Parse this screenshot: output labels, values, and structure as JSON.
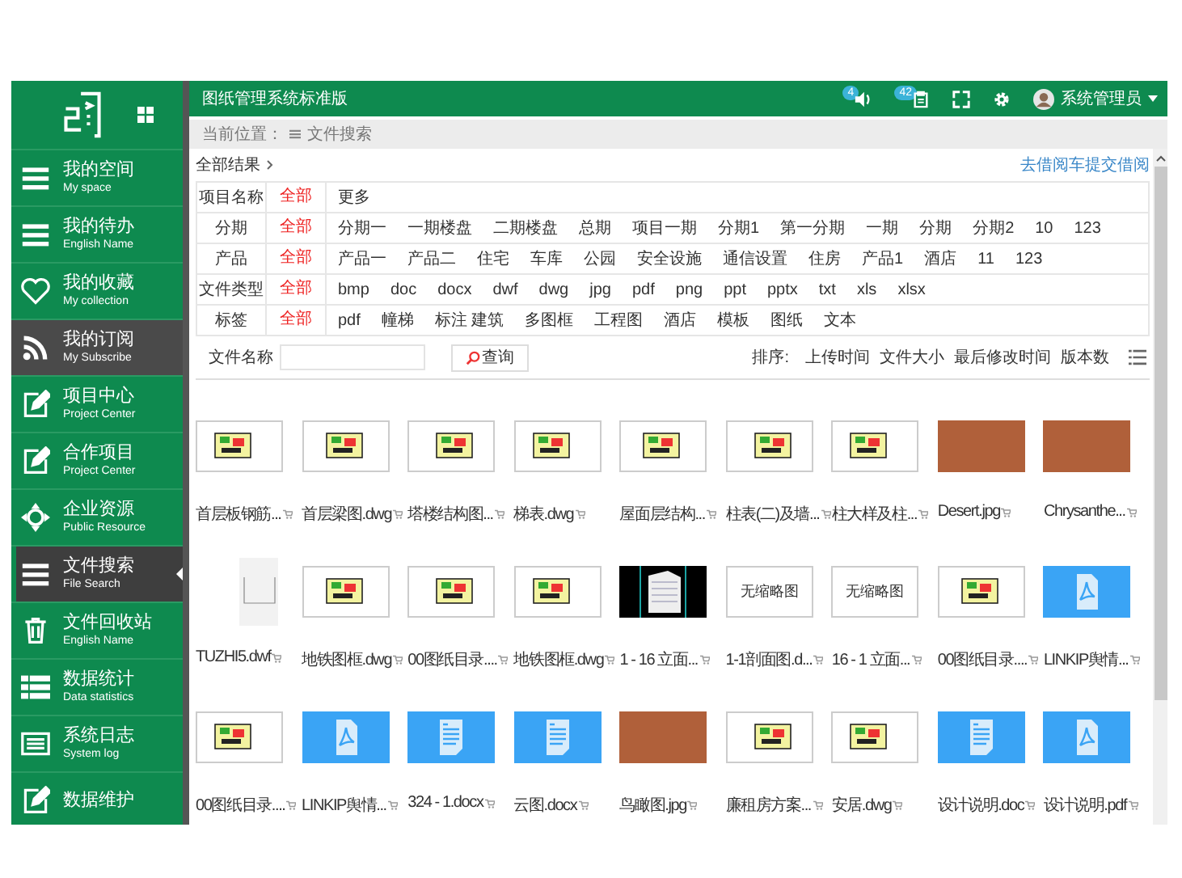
{
  "header": {
    "title": "图纸管理系统标准版",
    "notifications": [
      {
        "kind": "speaker",
        "badge": "4"
      },
      {
        "kind": "document",
        "badge": "42"
      }
    ],
    "user": "系统管理员"
  },
  "sidebar": {
    "items": [
      {
        "title": "我的空间",
        "subtitle": "My space",
        "kind": "menu",
        "selected": false,
        "hovered": false
      },
      {
        "title": "我的待办",
        "subtitle": "English Name",
        "kind": "menu",
        "selected": false,
        "hovered": false
      },
      {
        "title": "我的收藏",
        "subtitle": "My collection",
        "kind": "heart",
        "selected": false,
        "hovered": false
      },
      {
        "title": "我的订阅",
        "subtitle": "My Subscribe",
        "kind": "rss",
        "selected": false,
        "hovered": true
      },
      {
        "title": "项目中心",
        "subtitle": "Project Center",
        "kind": "edit",
        "selected": false,
        "hovered": false
      },
      {
        "title": "合作项目",
        "subtitle": "Project Center",
        "kind": "edit",
        "selected": false,
        "hovered": false
      },
      {
        "title": "企业资源",
        "subtitle": "Public Resource",
        "kind": "move",
        "selected": false,
        "hovered": false
      },
      {
        "title": "文件搜索",
        "subtitle": "File Search",
        "kind": "menu",
        "selected": true,
        "hovered": false
      },
      {
        "title": "文件回收站",
        "subtitle": "English Name",
        "kind": "trash",
        "selected": false,
        "hovered": false
      },
      {
        "title": "数据统计",
        "subtitle": "Data statistics",
        "kind": "table",
        "selected": false,
        "hovered": false
      },
      {
        "title": "系统日志",
        "subtitle": "System log",
        "kind": "log",
        "selected": false,
        "hovered": false
      },
      {
        "title": "数据维护",
        "kind": "edit",
        "selected": false,
        "hovered": false
      }
    ]
  },
  "breadcrumb": {
    "label": "当前位置：",
    "current": "文件搜索"
  },
  "results": {
    "label": "全部结果",
    "link": "去借阅车提交借阅"
  },
  "filters": [
    {
      "label": "项目名称",
      "options": [
        {
          "text": "全部",
          "selected": true
        },
        {
          "text": "更多",
          "selected": false
        }
      ]
    },
    {
      "label": "分期",
      "options": [
        {
          "text": "全部",
          "selected": true
        },
        {
          "text": "分期一",
          "selected": false
        },
        {
          "text": "一期楼盘",
          "selected": false
        },
        {
          "text": "二期楼盘",
          "selected": false
        },
        {
          "text": "总期",
          "selected": false
        },
        {
          "text": "项目一期",
          "selected": false
        },
        {
          "text": "分期1",
          "selected": false
        },
        {
          "text": "第一分期",
          "selected": false
        },
        {
          "text": "一期",
          "selected": false
        },
        {
          "text": "分期",
          "selected": false
        },
        {
          "text": "分期2",
          "selected": false
        },
        {
          "text": "10",
          "selected": false
        },
        {
          "text": "123",
          "selected": false
        }
      ]
    },
    {
      "label": "产品",
      "options": [
        {
          "text": "全部",
          "selected": true
        },
        {
          "text": "产品一",
          "selected": false
        },
        {
          "text": "产品二",
          "selected": false
        },
        {
          "text": "住宅",
          "selected": false
        },
        {
          "text": "车库",
          "selected": false
        },
        {
          "text": "公园",
          "selected": false
        },
        {
          "text": "安全设施",
          "selected": false
        },
        {
          "text": "通信设置",
          "selected": false
        },
        {
          "text": "住房",
          "selected": false
        },
        {
          "text": "产品1",
          "selected": false
        },
        {
          "text": "酒店",
          "selected": false
        },
        {
          "text": "11",
          "selected": false
        },
        {
          "text": "123",
          "selected": false
        }
      ]
    },
    {
      "label": "文件类型",
      "options": [
        {
          "text": "全部",
          "selected": true
        },
        {
          "text": "bmp",
          "selected": false
        },
        {
          "text": "doc",
          "selected": false
        },
        {
          "text": "docx",
          "selected": false
        },
        {
          "text": "dwf",
          "selected": false
        },
        {
          "text": "dwg",
          "selected": false
        },
        {
          "text": "jpg",
          "selected": false
        },
        {
          "text": "pdf",
          "selected": false
        },
        {
          "text": "png",
          "selected": false
        },
        {
          "text": "ppt",
          "selected": false
        },
        {
          "text": "pptx",
          "selected": false
        },
        {
          "text": "txt",
          "selected": false
        },
        {
          "text": "xls",
          "selected": false
        },
        {
          "text": "xlsx",
          "selected": false
        }
      ]
    },
    {
      "label": "标签",
      "options": [
        {
          "text": "全部",
          "selected": true
        },
        {
          "text": "pdf",
          "selected": false
        },
        {
          "text": "幢梯",
          "selected": false
        },
        {
          "text": "标注 建筑",
          "selected": false
        },
        {
          "text": "多图框",
          "selected": false
        },
        {
          "text": "工程图",
          "selected": false
        },
        {
          "text": "酒店",
          "selected": false
        },
        {
          "text": "模板",
          "selected": false
        },
        {
          "text": "图纸",
          "selected": false
        },
        {
          "text": "文本",
          "selected": false
        }
      ]
    }
  ],
  "search": {
    "label": "文件名称",
    "button": "查询"
  },
  "sort": {
    "label": "排序:",
    "options": [
      "上传时间",
      "文件大小",
      "最后修改时间",
      "版本数"
    ]
  },
  "files": [
    {
      "name": "首层板钢筋...",
      "kind": "drawing"
    },
    {
      "name": "首层梁图.dwg",
      "kind": "drawing"
    },
    {
      "name": "塔楼结构图...",
      "kind": "drawing"
    },
    {
      "name": "梯表.dwg",
      "kind": "drawing"
    },
    {
      "name": "屋面层结构...",
      "kind": "drawing"
    },
    {
      "name": "柱表(二)及墙...",
      "kind": "drawing"
    },
    {
      "name": "柱大样及柱...",
      "kind": "drawing"
    },
    {
      "name": "Desert.jpg",
      "kind": "photo"
    },
    {
      "name": "Chrysanthe...",
      "kind": "photo"
    },
    {
      "name": "TUZHI5.dwf",
      "kind": "sheet"
    },
    {
      "name": "地铁图框.dwg",
      "kind": "drawing"
    },
    {
      "name": "00图纸目录....",
      "kind": "drawing"
    },
    {
      "name": "地铁图框.dwg",
      "kind": "drawing"
    },
    {
      "name": "1 - 16 立面...",
      "kind": "dark"
    },
    {
      "name": "1-1剖面图.d...",
      "kind": "none",
      "thumb_text": "无缩略图"
    },
    {
      "name": "16 - 1 立面...",
      "kind": "none",
      "thumb_text": "无缩略图"
    },
    {
      "name": "00图纸目录....",
      "kind": "drawing"
    },
    {
      "name": "LINKIP舆情...",
      "kind": "pdf"
    },
    {
      "name": "00图纸目录....",
      "kind": "drawing"
    },
    {
      "name": "LINKIP舆情...",
      "kind": "pdf"
    },
    {
      "name": "324 - 1.docx",
      "kind": "word"
    },
    {
      "name": "云图.docx",
      "kind": "word"
    },
    {
      "name": "鸟瞰图.jpg",
      "kind": "photo"
    },
    {
      "name": "廉租房方案...",
      "kind": "drawing"
    },
    {
      "name": "安居.dwg",
      "kind": "drawing"
    },
    {
      "name": "设计说明.doc",
      "kind": "word"
    },
    {
      "name": "设计说明.pdf",
      "kind": "pdf"
    }
  ]
}
